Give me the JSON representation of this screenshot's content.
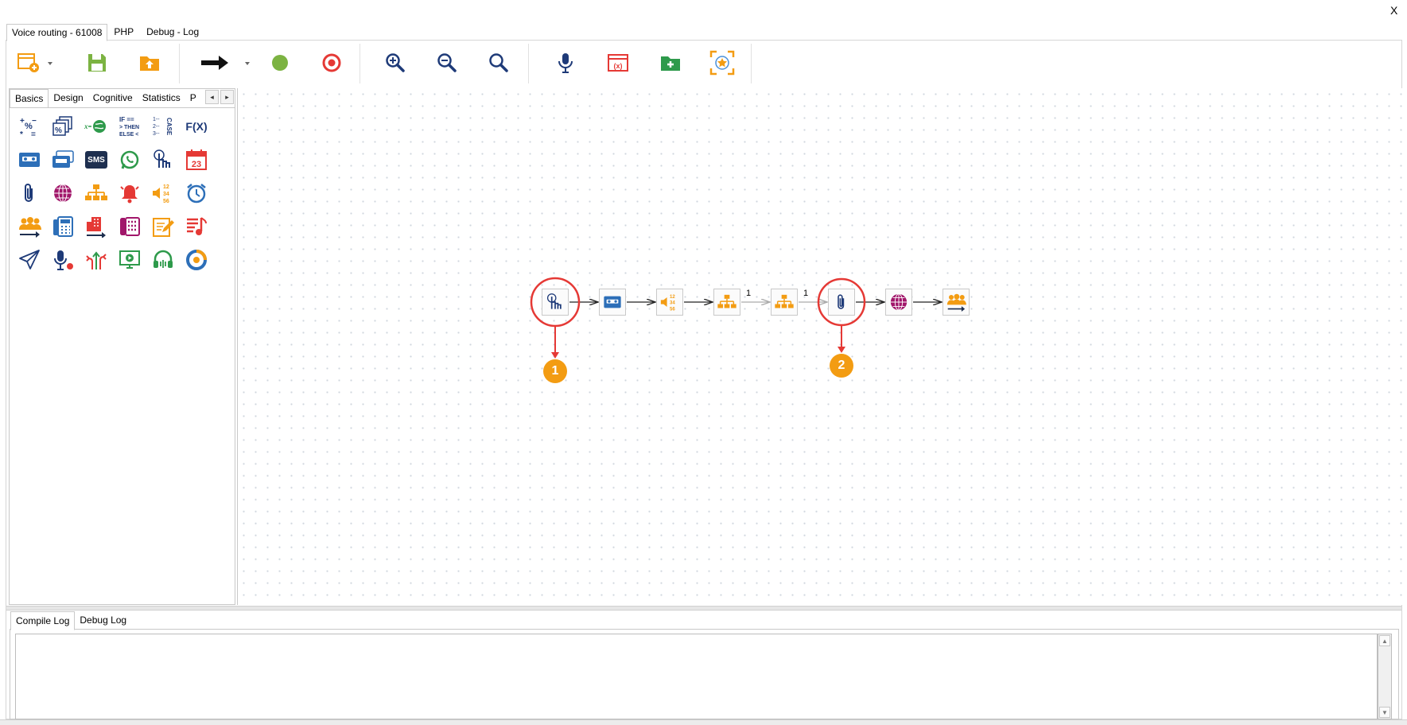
{
  "window": {
    "close_label": "X"
  },
  "top_tabs": [
    {
      "label": "Voice routing - 61008",
      "active": true
    },
    {
      "label": "PHP",
      "active": false
    },
    {
      "label": "Debug - Log",
      "active": false
    }
  ],
  "toolbar": {
    "buttons": [
      {
        "icon": "new-window-icon"
      },
      {
        "icon": "save-icon"
      },
      {
        "icon": "upload-folder-icon"
      },
      {
        "icon": "arrow-right-icon"
      },
      {
        "icon": "green-circle-icon"
      },
      {
        "icon": "red-target-icon"
      },
      {
        "icon": "zoom-in-icon"
      },
      {
        "icon": "zoom-out-icon"
      },
      {
        "icon": "zoom-fit-icon"
      },
      {
        "icon": "microphone-icon"
      },
      {
        "icon": "variables-window-icon"
      },
      {
        "icon": "add-folder-icon"
      },
      {
        "icon": "focus-star-icon"
      }
    ]
  },
  "palette": {
    "tabs": [
      {
        "label": "Basics",
        "active": true
      },
      {
        "label": "Design",
        "active": false
      },
      {
        "label": "Cognitive",
        "active": false
      },
      {
        "label": "Statistics",
        "active": false
      },
      {
        "label": "Pı",
        "active": false
      }
    ],
    "scroll_left": "◂",
    "scroll_right": "▸",
    "icon_labels": {
      "sms": "SMS",
      "calendar_day": "23",
      "fx": "F(X)"
    },
    "icons": [
      "math-operators-icon",
      "percent-calc-icon",
      "variable-globe-icon",
      "if-then-else-icon",
      "case-icon",
      "function-icon",
      "cassette-icon",
      "cassette-stack-icon",
      "sms-icon",
      "whatsapp-icon",
      "touch-input-icon",
      "calendar-icon",
      "paperclip-icon",
      "globe-icon",
      "org-chart-icon",
      "alarm-bell-icon",
      "audio-numbers-icon",
      "alarm-clock-icon",
      "agent-queue-icon",
      "phone-list-icon",
      "building-route-icon",
      "phone-keypad-icon",
      "note-edit-icon",
      "music-list-icon",
      "send-icon",
      "mic-record-icon",
      "branch-arrows-icon",
      "screen-play-icon",
      "headset-icon",
      "ring-icon"
    ]
  },
  "flow": {
    "edge_labels": [
      "1",
      "1"
    ],
    "badges": [
      "1",
      "2"
    ],
    "colors": {
      "annotation": "#e53935",
      "badge": "#f39c12",
      "navy": "#1e3a78",
      "orange": "#f39c12"
    }
  },
  "log": {
    "tabs": [
      {
        "label": "Compile Log",
        "active": true
      },
      {
        "label": "Debug Log",
        "active": false
      }
    ],
    "content": "",
    "scroll_up": "▲",
    "scroll_down": "▼"
  }
}
